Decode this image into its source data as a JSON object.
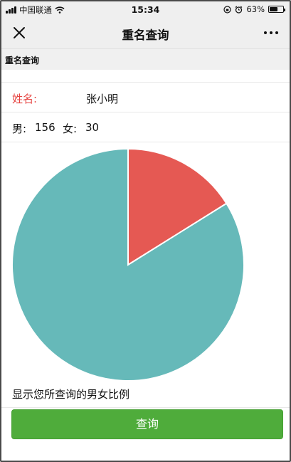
{
  "status_bar": {
    "carrier": "中国联通",
    "time": "15:34",
    "battery_text": "63%",
    "battery_level": 0.63
  },
  "nav": {
    "title": "重名查询",
    "close_icon": "close-icon",
    "more_icon": "more-icon"
  },
  "page_header": "重名查询",
  "form": {
    "name_label": "姓名:",
    "name_value": "张小明"
  },
  "counts": {
    "male_label": "男:",
    "male_value": "156",
    "female_label": "女:",
    "female_value": "30"
  },
  "chart_data": {
    "type": "pie",
    "slices": [
      {
        "label": "女",
        "value": 30,
        "color": "#e55953"
      },
      {
        "label": "男",
        "value": 156,
        "color": "#66b9b9"
      }
    ],
    "start_angle_deg": 0,
    "direction": "clockwise"
  },
  "caption": "显示您所查询的男女比例",
  "query_button": "查询",
  "colors": {
    "accent_green": "#4fac3b",
    "label_red": "#e64340",
    "nav_bg": "#efefef"
  }
}
